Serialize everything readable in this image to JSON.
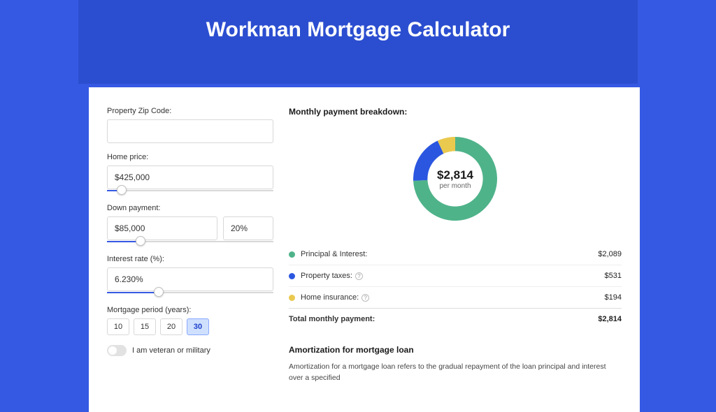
{
  "header": {
    "title": "Workman Mortgage Calculator"
  },
  "form": {
    "zip_label": "Property Zip Code:",
    "zip_value": "",
    "home_price_label": "Home price:",
    "home_price_value": "$425,000",
    "home_price_slider_pct": 9,
    "down_payment_label": "Down payment:",
    "down_payment_value": "$85,000",
    "down_payment_pct_value": "20%",
    "down_payment_slider_pct": 20,
    "interest_label": "Interest rate (%):",
    "interest_value": "6.230%",
    "interest_slider_pct": 31,
    "period_label": "Mortgage period (years):",
    "periods": [
      "10",
      "15",
      "20",
      "30"
    ],
    "period_selected_index": 3,
    "veteran_label": "I am veteran or military",
    "veteran_on": false
  },
  "breakdown": {
    "title": "Monthly payment breakdown:",
    "center_amount": "$2,814",
    "center_sub": "per month",
    "items": [
      {
        "label": "Principal & Interest:",
        "value": "$2,089",
        "color": "green",
        "help": false,
        "num": 2089
      },
      {
        "label": "Property taxes:",
        "value": "$531",
        "color": "blue",
        "help": true,
        "num": 531
      },
      {
        "label": "Home insurance:",
        "value": "$194",
        "color": "yellow",
        "help": true,
        "num": 194
      }
    ],
    "total_label": "Total monthly payment:",
    "total_value": "$2,814"
  },
  "chart_data": {
    "type": "pie",
    "title": "Monthly payment breakdown",
    "series": [
      {
        "name": "Principal & Interest",
        "value": 2089,
        "color": "#4fb38a"
      },
      {
        "name": "Property taxes",
        "value": 531,
        "color": "#2b56e0"
      },
      {
        "name": "Home insurance",
        "value": 194,
        "color": "#eac94f"
      }
    ],
    "total": 2814,
    "center_label": "$2,814 per month",
    "donut_hole_ratio": 0.66
  },
  "amortization": {
    "title": "Amortization for mortgage loan",
    "text": "Amortization for a mortgage loan refers to the gradual repayment of the loan principal and interest over a specified"
  }
}
